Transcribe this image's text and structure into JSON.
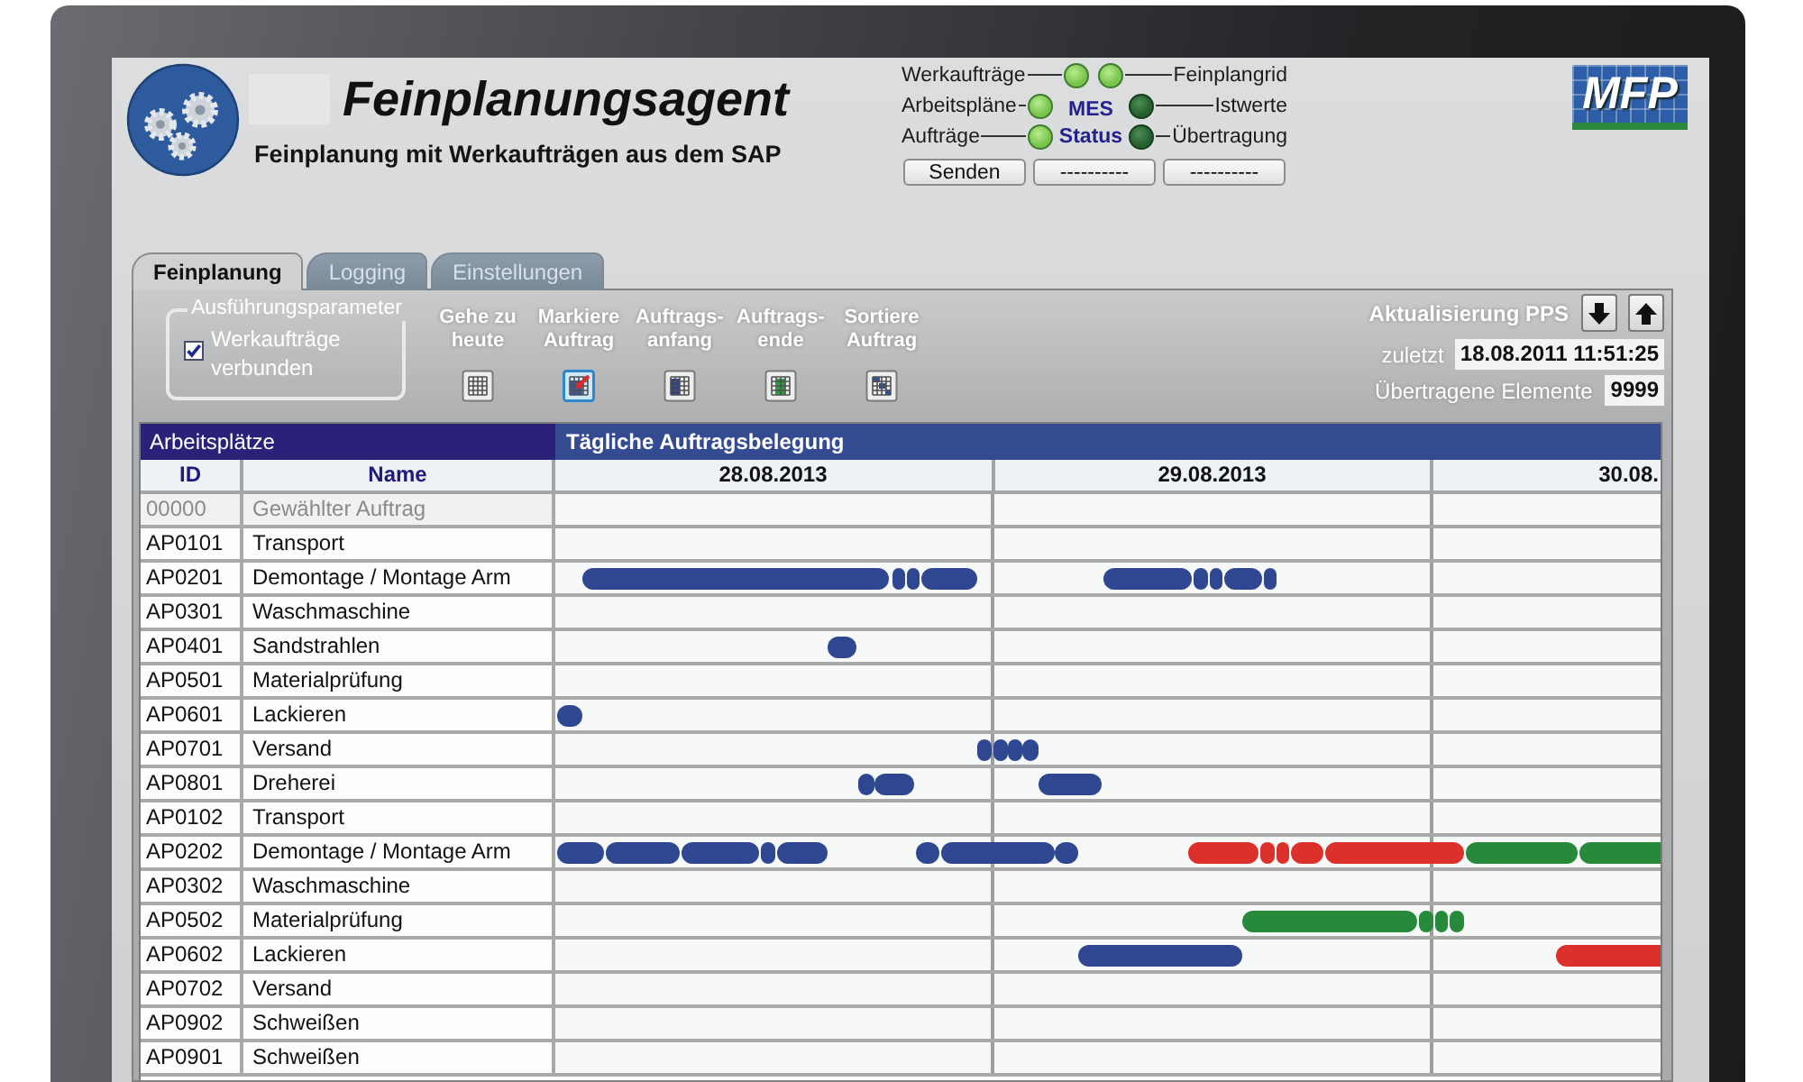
{
  "header": {
    "title": "Feinplanungsagent",
    "subtitle": "Feinplanung mit Werkaufträgen aus dem SAP",
    "logo_text": "MFP"
  },
  "status": {
    "indicators": [
      {
        "label": "Werkaufträge",
        "active": true
      },
      {
        "label": "Feinplangrid",
        "active": true
      },
      {
        "label": "Arbeitspläne",
        "active": true
      },
      {
        "label": "Istwerte",
        "active": false
      },
      {
        "label": "Aufträge",
        "active": true
      },
      {
        "label": "Übertragung",
        "active": false
      }
    ],
    "center_labels": [
      "MES",
      "Status"
    ],
    "buttons": [
      "Senden",
      "----------",
      "----------"
    ]
  },
  "tabs": [
    {
      "label": "Feinplanung",
      "selected": true
    },
    {
      "label": "Logging",
      "selected": false
    },
    {
      "label": "Einstellungen",
      "selected": false
    }
  ],
  "toolbar": {
    "group": {
      "title": "Ausführungsparameter",
      "checkbox": {
        "label": "Werkaufträge verbunden",
        "checked": true
      }
    },
    "buttons": [
      {
        "label": "Gehe zu heute",
        "selected": false
      },
      {
        "label": "Markiere Auftrag",
        "selected": true
      },
      {
        "label": "Auftrags- anfang",
        "selected": false
      },
      {
        "label": "Auftrags- ende",
        "selected": false
      },
      {
        "label": "Sortiere Auftrag",
        "selected": false
      }
    ],
    "update": {
      "title": "Aktualisierung PPS",
      "last_label": "zuletzt",
      "last_value": "18.08.2011 11:51:25",
      "count_label": "Übertragene Elemente",
      "count_value": "9999"
    }
  },
  "table": {
    "sections": [
      "Arbeitsplätze",
      "Tägliche Auftragsbelegung"
    ],
    "columns": [
      "ID",
      "Name"
    ],
    "dates": [
      "28.08.2013",
      "29.08.2013",
      "30.08."
    ],
    "rows": [
      {
        "id": "00000",
        "name": "Gewählter Auftrag",
        "kind": "selection"
      },
      {
        "id": "AP0101",
        "name": "Transport",
        "kind": "station"
      },
      {
        "id": "AP0201",
        "name": "Demontage / Montage Arm",
        "kind": "station"
      },
      {
        "id": "AP0301",
        "name": "Waschmaschine",
        "kind": "station"
      },
      {
        "id": "AP0401",
        "name": "Sandstrahlen",
        "kind": "station"
      },
      {
        "id": "AP0501",
        "name": "Materialprüfung",
        "kind": "station"
      },
      {
        "id": "AP0601",
        "name": "Lackieren",
        "kind": "station"
      },
      {
        "id": "AP0701",
        "name": "Versand",
        "kind": "station"
      },
      {
        "id": "AP0801",
        "name": "Dreherei",
        "kind": "station"
      },
      {
        "id": "AP0102",
        "name": "Transport",
        "kind": "station"
      },
      {
        "id": "AP0202",
        "name": "Demontage / Montage Arm",
        "kind": "station"
      },
      {
        "id": "AP0302",
        "name": "Waschmaschine",
        "kind": "station"
      },
      {
        "id": "AP0502",
        "name": "Materialprüfung",
        "kind": "station"
      },
      {
        "id": "AP0602",
        "name": "Lackieren",
        "kind": "station"
      },
      {
        "id": "AP0702",
        "name": "Versand",
        "kind": "station"
      },
      {
        "id": "AP0902",
        "name": "Schweißen",
        "kind": "station"
      },
      {
        "id": "AP0901",
        "name": "Schweißen",
        "kind": "station"
      }
    ]
  }
}
